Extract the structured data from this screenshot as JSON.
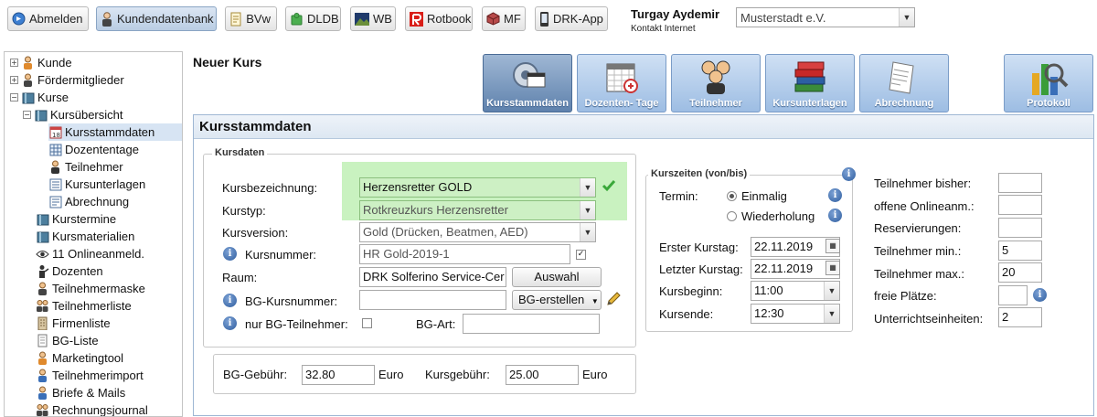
{
  "toolbar": {
    "buttons": [
      {
        "label": "Abmelden",
        "icon": "logout-icon"
      },
      {
        "label": "Kundendatenbank",
        "icon": "person-icon",
        "active": true
      },
      {
        "label": "BVw",
        "icon": "document-icon"
      },
      {
        "label": "DLDB",
        "icon": "puzzle-icon"
      },
      {
        "label": "WB",
        "icon": "landscape-icon"
      },
      {
        "label": "Rotbook",
        "icon": "rotbook-logo-icon"
      },
      {
        "label": "MF",
        "icon": "cube-icon"
      },
      {
        "label": "DRK-App",
        "icon": "phone-icon"
      }
    ],
    "user_name": "Turgay Aydemir",
    "user_sub": "Kontakt Internet",
    "org_select": "Musterstadt e.V."
  },
  "sidebar": {
    "items": [
      {
        "label": "Kunde"
      },
      {
        "label": "Fördermitglieder"
      },
      {
        "label": "Kurse"
      },
      {
        "label": "Kursübersicht"
      },
      {
        "label": "Kursstammdaten"
      },
      {
        "label": "Dozententage"
      },
      {
        "label": "Teilnehmer"
      },
      {
        "label": "Kursunterlagen"
      },
      {
        "label": "Abrechnung"
      },
      {
        "label": "Kurstermine"
      },
      {
        "label": "Kursmaterialien"
      },
      {
        "label": "11 Onlineanmeld."
      },
      {
        "label": "Dozenten"
      },
      {
        "label": "Teilnehmermaske"
      },
      {
        "label": "Teilnehmerliste"
      },
      {
        "label": "Firmenliste"
      },
      {
        "label": "BG-Liste"
      },
      {
        "label": "Marketingtool"
      },
      {
        "label": "Teilnehmerimport"
      },
      {
        "label": "Briefe & Mails"
      },
      {
        "label": "Rechnungsjournal"
      }
    ]
  },
  "main": {
    "page_title": "Neuer Kurs",
    "tiles": [
      {
        "label": "Kursstammdaten"
      },
      {
        "label": "Dozenten- Tage"
      },
      {
        "label": "Teilnehmer"
      },
      {
        "label": "Kursunterlagen"
      },
      {
        "label": "Abrechnung"
      },
      {
        "label": "Protokoll"
      }
    ],
    "section_title": "Kursstammdaten",
    "kursdaten": {
      "legend": "Kursdaten",
      "kursbezeichnung_label": "Kursbezeichnung:",
      "kursbezeichnung_value": "Herzensretter GOLD",
      "kurstyp_label": "Kurstyp:",
      "kurstyp_value": "Rotkreuzkurs Herzensretter",
      "kursversion_label": "Kursversion:",
      "kursversion_value": "Gold (Drücken, Beatmen, AED)",
      "kursnummer_label": "Kursnummer:",
      "kursnummer_value": "HR Gold-2019-1",
      "raum_label": "Raum:",
      "raum_value": "DRK Solferino Service-Cer",
      "auswahl_label": "Auswahl",
      "bg_kursnummer_label": "BG-Kursnummer:",
      "bg_kursnummer_value": "",
      "bg_erstellen_label": "BG-erstellen",
      "nur_bg_label": "nur BG-Teilnehmer:",
      "bg_art_label": "BG-Art:",
      "bg_art_value": ""
    },
    "fees": {
      "bg_gebuehr_label": "BG-Gebühr:",
      "bg_gebuehr_value": "32.80",
      "bg_currency": "Euro",
      "kursgebuehr_label": "Kursgebühr:",
      "kursgebuehr_value": "25.00",
      "kurs_currency": "Euro"
    },
    "kurszeiten": {
      "legend": "Kurszeiten (von/bis)",
      "termin_label": "Termin:",
      "einmalig_label": "Einmalig",
      "wiederholung_label": "Wiederholung",
      "erster_label": "Erster Kurstag:",
      "erster_value": "22.11.2019",
      "letzter_label": "Letzter Kurstag:",
      "letzter_value": "22.11.2019",
      "beginn_label": "Kursbeginn:",
      "beginn_value": "11:00",
      "ende_label": "Kursende:",
      "ende_value": "12:30"
    },
    "teilnehmer": {
      "bisher_label": "Teilnehmer bisher:",
      "bisher_value": "",
      "online_label": "offene Onlineanm.:",
      "online_value": "",
      "reserv_label": "Reservierungen:",
      "reserv_value": "",
      "min_label": "Teilnehmer min.:",
      "min_value": "5",
      "max_label": "Teilnehmer max.:",
      "max_value": "20",
      "frei_label": "freie Plätze:",
      "frei_value": "",
      "ue_label": "Unterrichtseinheiten:",
      "ue_value": "2"
    }
  }
}
